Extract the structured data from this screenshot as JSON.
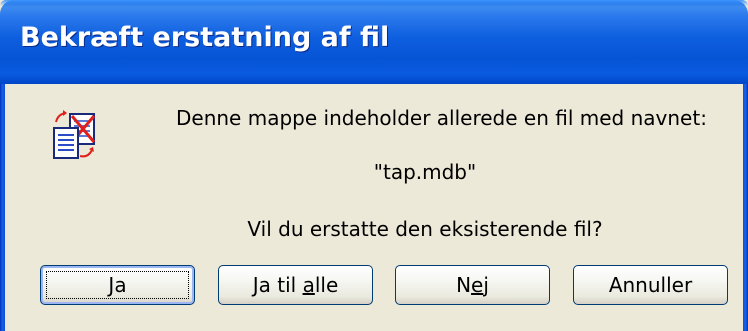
{
  "window": {
    "title": "Bekræft erstatning af fil"
  },
  "icon": {
    "name": "file-replace-icon"
  },
  "message": {
    "line1": "Denne mappe indeholder allerede en fil med navnet:",
    "filename": "\"tap.mdb\"",
    "question": "Vil du erstatte den eksisterende fil?"
  },
  "buttons": {
    "yes": {
      "pre": "",
      "mnemonic": "J",
      "post": "a"
    },
    "yes_all": {
      "pre": "Ja til ",
      "mnemonic": "a",
      "post": "lle"
    },
    "no": {
      "pre": "N",
      "mnemonic": "e",
      "post": "j"
    },
    "cancel": {
      "pre": "Annuller",
      "mnemonic": "",
      "post": ""
    }
  },
  "colors": {
    "titlebar": "#0a5ae0",
    "dialog_bg": "#ece9d8",
    "button_border": "#003c74"
  }
}
